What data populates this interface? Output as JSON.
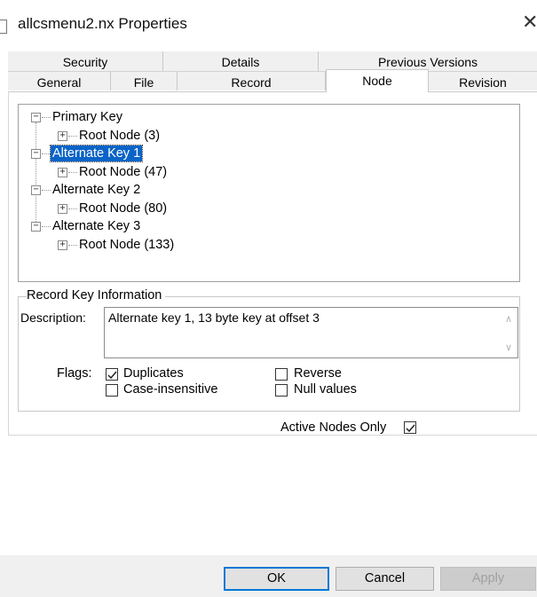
{
  "window": {
    "title": "allcsmenu2.nx Properties",
    "close_glyph": "✕",
    "icons": {
      "file": "file-icon",
      "close": "close-icon"
    }
  },
  "tabs": {
    "top_row": [
      {
        "label": "Security"
      },
      {
        "label": "Details"
      },
      {
        "label": "Previous Versions"
      }
    ],
    "bottom_row": [
      {
        "label": "General"
      },
      {
        "label": "File"
      },
      {
        "label": "Record"
      },
      {
        "label": "Node",
        "active": true
      },
      {
        "label": "Revision"
      }
    ]
  },
  "tree": {
    "items": [
      {
        "label": "Primary Key",
        "expanded": true,
        "selected": false,
        "child": "Root Node (3)"
      },
      {
        "label": "Alternate Key 1",
        "expanded": true,
        "selected": true,
        "child": "Root Node (47)"
      },
      {
        "label": "Alternate Key 2",
        "expanded": true,
        "selected": false,
        "child": "Root Node (80)"
      },
      {
        "label": "Alternate Key 3",
        "expanded": true,
        "selected": false,
        "child": "Root Node (133)"
      }
    ],
    "collapse_glyph": "−",
    "expand_glyph": "+",
    "selected_color": "#0a64c8"
  },
  "record_key_info": {
    "group_title": "Record Key Information",
    "description_label": "Description:",
    "description_value": "Alternate key 1, 13 byte key at offset 3",
    "scroll_up_glyph": "∧",
    "scroll_down_glyph": "∨",
    "flags_label": "Flags:",
    "flags": [
      {
        "label": "Duplicates",
        "checked": true
      },
      {
        "label": "Reverse",
        "checked": false
      },
      {
        "label": "Case-insensitive",
        "checked": false
      },
      {
        "label": "Null values",
        "checked": false
      }
    ]
  },
  "active_nodes_only": {
    "label": "Active Nodes Only",
    "checked": true
  },
  "buttons": {
    "ok": "OK",
    "cancel": "Cancel",
    "apply": "Apply"
  },
  "colors": {
    "accent": "#0078d7",
    "selection": "#0a64c8",
    "tab_bg": "#f0f0f0"
  }
}
